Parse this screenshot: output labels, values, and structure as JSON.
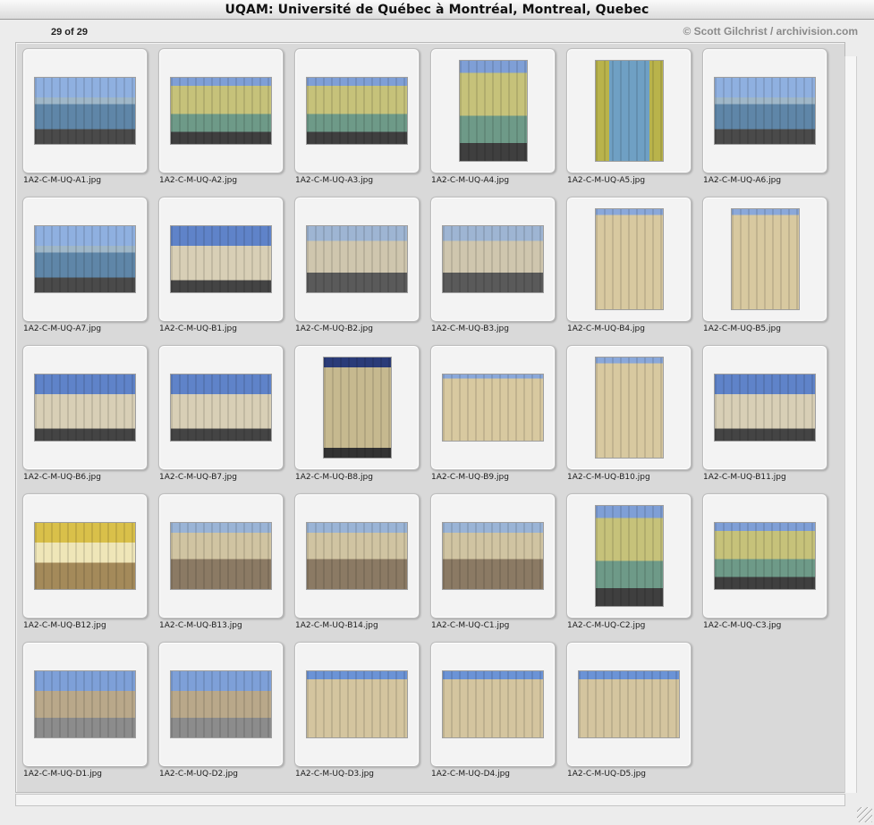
{
  "window": {
    "title": "UQAM: Université de Québec à Montréal, Montreal, Quebec"
  },
  "info": {
    "count": "29 of 29",
    "credit": "© Scott Gilchrist / archivision.com"
  },
  "slides": [
    {
      "label": "1A2-C-M-UQ-A1.jpg",
      "orientation": "land",
      "tone": "glass-blue"
    },
    {
      "label": "1A2-C-M-UQ-A2.jpg",
      "orientation": "land",
      "tone": "glass-green"
    },
    {
      "label": "1A2-C-M-UQ-A3.jpg",
      "orientation": "land",
      "tone": "glass-green"
    },
    {
      "label": "1A2-C-M-UQ-A4.jpg",
      "orientation": "port",
      "tone": "glass-green"
    },
    {
      "label": "1A2-C-M-UQ-A5.jpg",
      "orientation": "port",
      "tone": "glass-yellow"
    },
    {
      "label": "1A2-C-M-UQ-A6.jpg",
      "orientation": "land",
      "tone": "glass-blue"
    },
    {
      "label": "1A2-C-M-UQ-A7.jpg",
      "orientation": "land",
      "tone": "glass-blue"
    },
    {
      "label": "1A2-C-M-UQ-B1.jpg",
      "orientation": "land",
      "tone": "stone-sky"
    },
    {
      "label": "1A2-C-M-UQ-B2.jpg",
      "orientation": "land",
      "tone": "stone-street"
    },
    {
      "label": "1A2-C-M-UQ-B3.jpg",
      "orientation": "land",
      "tone": "stone-street"
    },
    {
      "label": "1A2-C-M-UQ-B4.jpg",
      "orientation": "port",
      "tone": "stone-facade"
    },
    {
      "label": "1A2-C-M-UQ-B5.jpg",
      "orientation": "port",
      "tone": "stone-facade"
    },
    {
      "label": "1A2-C-M-UQ-B6.jpg",
      "orientation": "land",
      "tone": "stone-sky"
    },
    {
      "label": "1A2-C-M-UQ-B7.jpg",
      "orientation": "land",
      "tone": "stone-sky"
    },
    {
      "label": "1A2-C-M-UQ-B8.jpg",
      "orientation": "port",
      "tone": "stone-dark"
    },
    {
      "label": "1A2-C-M-UQ-B9.jpg",
      "orientation": "land",
      "tone": "stone-facade"
    },
    {
      "label": "1A2-C-M-UQ-B10.jpg",
      "orientation": "port",
      "tone": "stone-facade"
    },
    {
      "label": "1A2-C-M-UQ-B11.jpg",
      "orientation": "land",
      "tone": "stone-sky"
    },
    {
      "label": "1A2-C-M-UQ-B12.jpg",
      "orientation": "land",
      "tone": "interior"
    },
    {
      "label": "1A2-C-M-UQ-B13.jpg",
      "orientation": "land",
      "tone": "courtyard"
    },
    {
      "label": "1A2-C-M-UQ-B14.jpg",
      "orientation": "land",
      "tone": "courtyard"
    },
    {
      "label": "1A2-C-M-UQ-C1.jpg",
      "orientation": "land",
      "tone": "courtyard"
    },
    {
      "label": "1A2-C-M-UQ-C2.jpg",
      "orientation": "port",
      "tone": "glass-green"
    },
    {
      "label": "1A2-C-M-UQ-C3.jpg",
      "orientation": "land",
      "tone": "glass-green"
    },
    {
      "label": "1A2-C-M-UQ-D1.jpg",
      "orientation": "land",
      "tone": "old-brick"
    },
    {
      "label": "1A2-C-M-UQ-D2.jpg",
      "orientation": "land",
      "tone": "old-brick"
    },
    {
      "label": "1A2-C-M-UQ-D3.jpg",
      "orientation": "land",
      "tone": "old-stone"
    },
    {
      "label": "1A2-C-M-UQ-D4.jpg",
      "orientation": "land",
      "tone": "old-stone"
    },
    {
      "label": "1A2-C-M-UQ-D5.jpg",
      "orientation": "land",
      "tone": "old-stone"
    }
  ]
}
